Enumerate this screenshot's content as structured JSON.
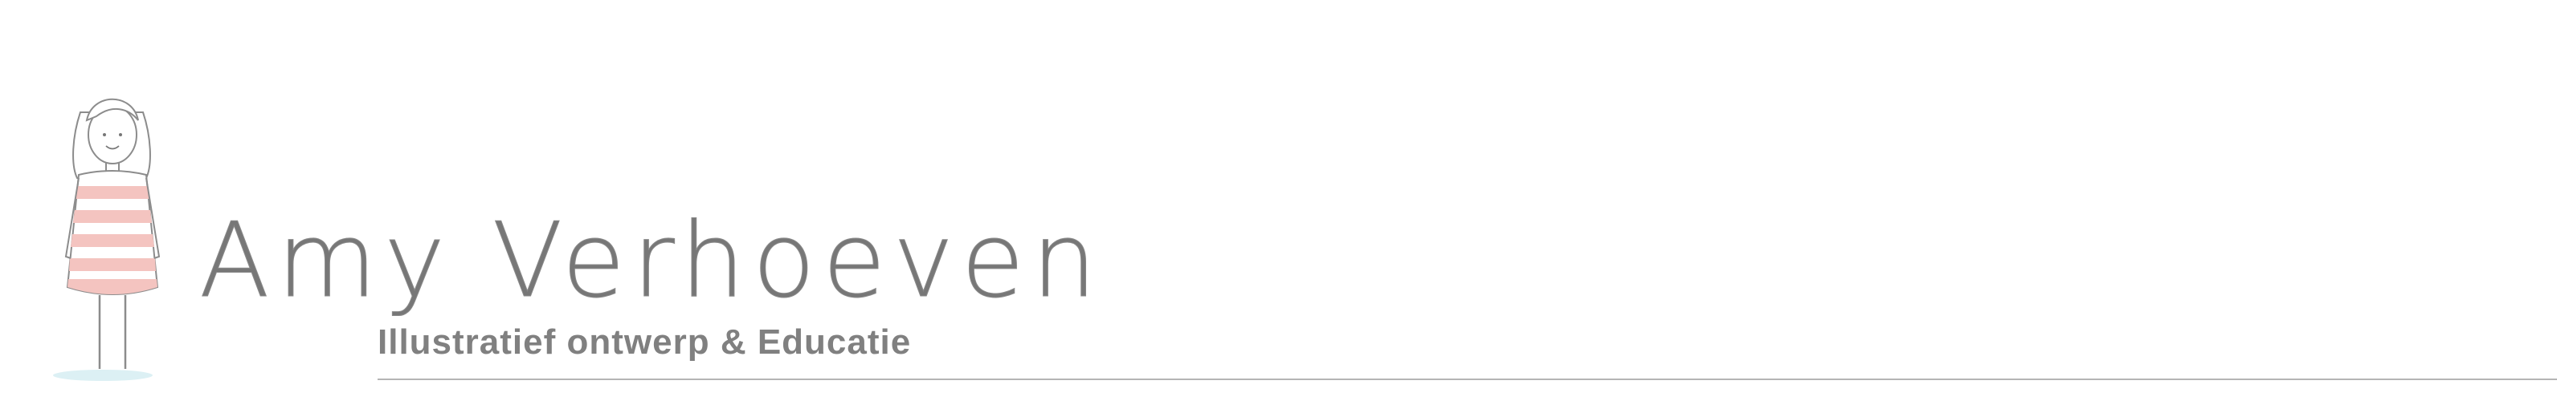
{
  "header": {
    "site_name": "Amy Verhoeven",
    "tagline": "Illustratief ontwerp & Educatie",
    "logo_icon": "girl-illustration-icon",
    "colors": {
      "text": "#777777",
      "stripes": "#f4c4c0",
      "rule": "#b5b5b5"
    }
  }
}
